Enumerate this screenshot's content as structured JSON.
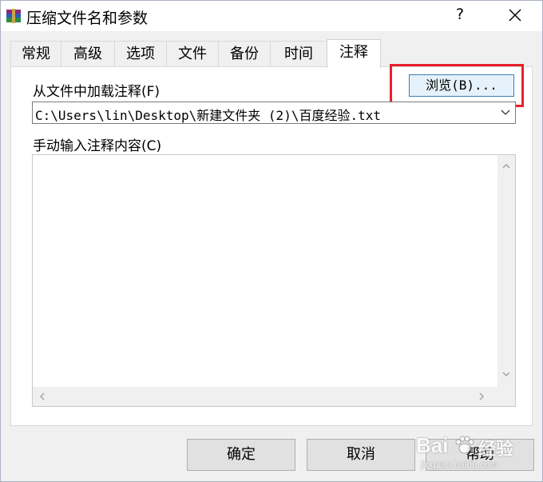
{
  "window": {
    "title": "压缩文件名和参数",
    "help_glyph": "?",
    "close_glyph": "×"
  },
  "tabs": [
    {
      "label": "常规"
    },
    {
      "label": "高级"
    },
    {
      "label": "选项"
    },
    {
      "label": "文件"
    },
    {
      "label": "备份"
    },
    {
      "label": "时间"
    },
    {
      "label": "注释",
      "active": true
    }
  ],
  "comment": {
    "load_label": "从文件中加载注释(F)",
    "browse_label": "浏览(B)...",
    "file_path": "C:\\Users\\lin\\Desktop\\新建文件夹 (2)\\百度经验.txt",
    "manual_label": "手动输入注释内容(C)",
    "manual_text": ""
  },
  "buttons": {
    "ok": "确定",
    "cancel": "取消",
    "help": "帮助"
  },
  "watermark": {
    "brand": "Bai",
    "brand_cn": "经验",
    "url": "jingyan.baidu.com"
  },
  "colors": {
    "highlight": "#e8202a",
    "browse_bg": "#e5f1fb",
    "browse_border": "#3c7fb1"
  }
}
